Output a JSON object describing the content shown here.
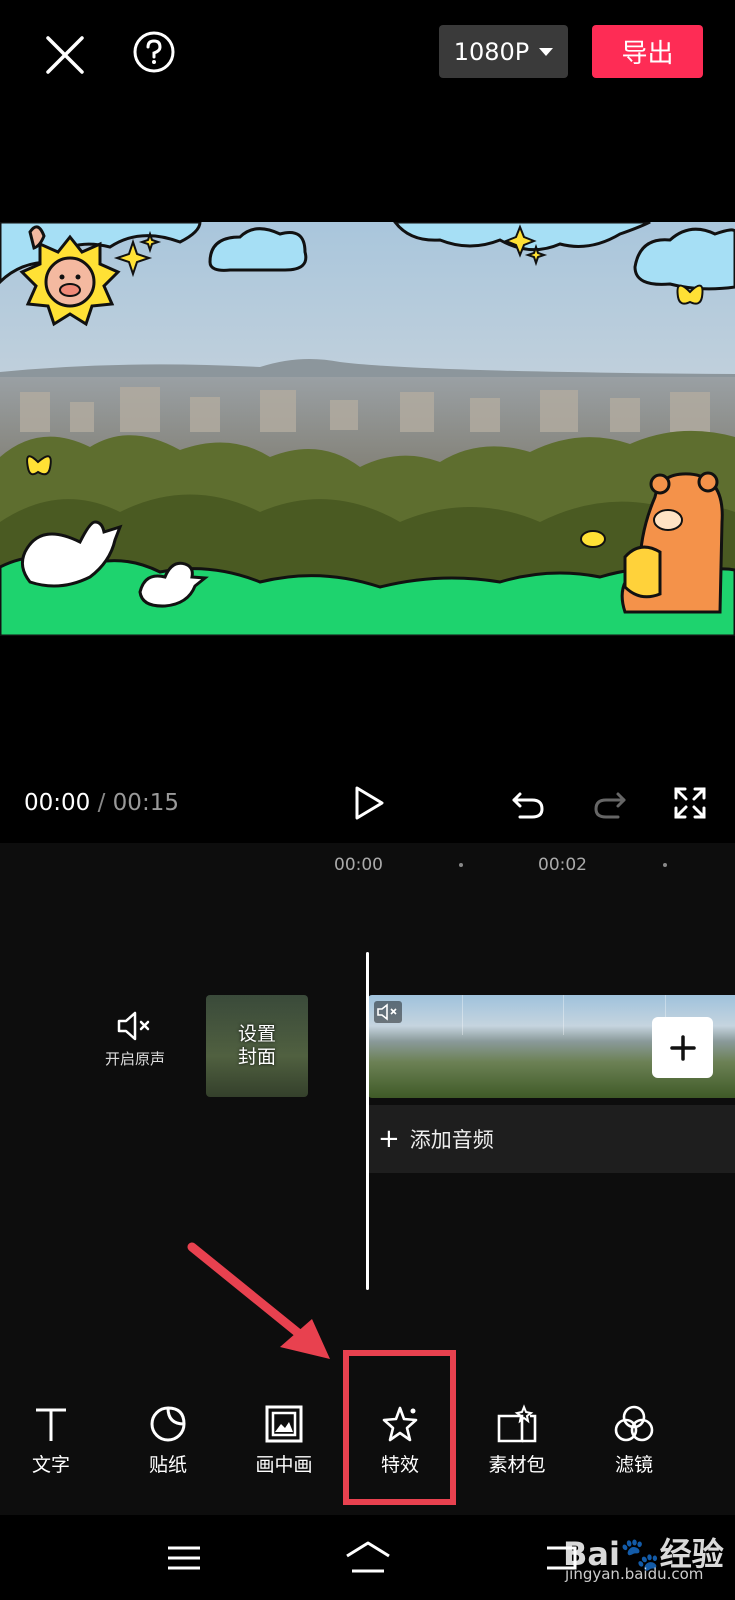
{
  "topbar": {
    "resolution_label": "1080P",
    "export_label": "导出",
    "close_icon": "close-icon",
    "help_icon": "help-icon"
  },
  "player": {
    "current_time": "00:00",
    "separator": "/",
    "total_time": "00:15"
  },
  "timeline": {
    "ruler": [
      "00:00",
      "00:02"
    ],
    "mute_label": "开启原声",
    "cover_label_line1": "设置",
    "cover_label_line2": "封面",
    "add_audio_label": "添加音频"
  },
  "toolbar": {
    "items": [
      {
        "label": "文字",
        "icon": "text-icon"
      },
      {
        "label": "贴纸",
        "icon": "sticker-icon"
      },
      {
        "label": "画中画",
        "icon": "picture-in-picture-icon"
      },
      {
        "label": "特效",
        "icon": "effects-star-icon"
      },
      {
        "label": "素材包",
        "icon": "material-pack-icon"
      },
      {
        "label": "滤镜",
        "icon": "filter-icon"
      }
    ]
  },
  "watermark": {
    "brand": "Bai",
    "brand2": "经验",
    "url": "jingyan.baidu.com"
  },
  "colors": {
    "accent": "#fe2c55",
    "annotation": "#e8414f"
  }
}
